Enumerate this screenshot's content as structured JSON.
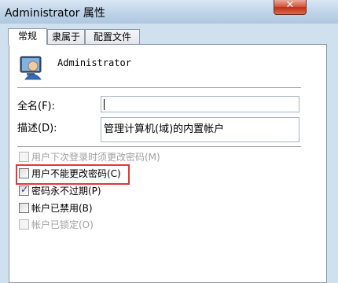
{
  "window": {
    "title": "Administrator 属性",
    "close_glyph": "✕",
    "help_glyph": "?"
  },
  "tabs": [
    {
      "label": "常规"
    },
    {
      "label": "隶属于"
    },
    {
      "label": "配置文件"
    }
  ],
  "user": {
    "name": "Administrator",
    "icon": "user-avatar-icon"
  },
  "fields": {
    "fullname_label": "全名(F):",
    "fullname_value": "",
    "description_label": "描述(D):",
    "description_value": "管理计算机(域)的内置帐户"
  },
  "options": [
    {
      "label": "用户下次登录时须更改密码(M)",
      "checked": false,
      "disabled": true
    },
    {
      "label": "用户不能更改密码(C)",
      "checked": false,
      "disabled": false
    },
    {
      "label": "密码永不过期(P)",
      "checked": true,
      "disabled": false
    },
    {
      "label": "帐户已禁用(B)",
      "checked": false,
      "disabled": false
    },
    {
      "label": "帐户已锁定(O)",
      "checked": false,
      "disabled": true
    }
  ],
  "colors": {
    "highlight": "#e0383d",
    "accent": "#1b3a87"
  }
}
